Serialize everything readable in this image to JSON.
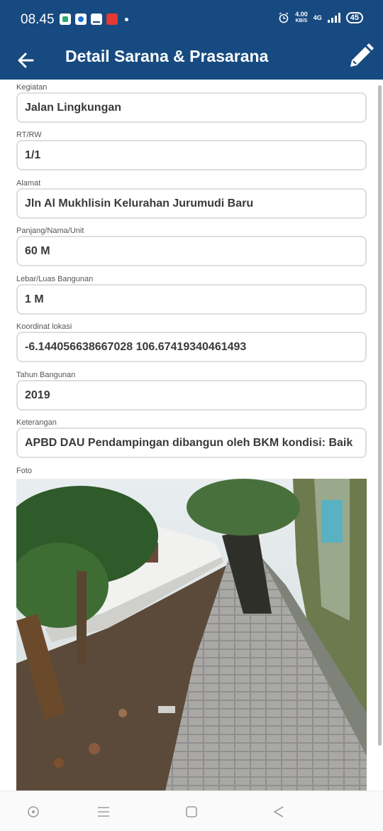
{
  "status_bar": {
    "time": "08.45",
    "net_speed_value": "4.00",
    "net_speed_unit": "KB/S",
    "network_type": "4G",
    "battery_level": "45"
  },
  "app_bar": {
    "title": "Detail Sarana & Prasarana",
    "back_icon": "arrow-left-icon",
    "edit_icon": "pencil-icon"
  },
  "fields": [
    {
      "label": "Kegiatan",
      "value": "Jalan Lingkungan"
    },
    {
      "label": "RT/RW",
      "value": "1/1"
    },
    {
      "label": "Alamat",
      "value": "Jln Al Mukhlisin Kelurahan Jurumudi Baru"
    },
    {
      "label": "Panjang/Nama/Unit",
      "value": "60 M"
    },
    {
      "label": "Lebar/Luas Bangunan",
      "value": "1 M"
    },
    {
      "label": "Koordinat lokasi",
      "value": "-6.144056638667028 106.67419340461493"
    },
    {
      "label": "Tahun Bangunan",
      "value": "2019"
    },
    {
      "label": "Keterangan",
      "value": "APBD DAU Pendampingan dibangun oleh BKM kondisi: Baik"
    }
  ],
  "photo": {
    "label": "Foto"
  },
  "colors": {
    "primary": "#174a80",
    "field_border": "#dedede",
    "value_text": "#3a3a3a"
  },
  "nav_bar": {
    "icons": [
      "circle-dot-icon",
      "menu-icon",
      "square-icon",
      "back-triangle-icon"
    ]
  }
}
